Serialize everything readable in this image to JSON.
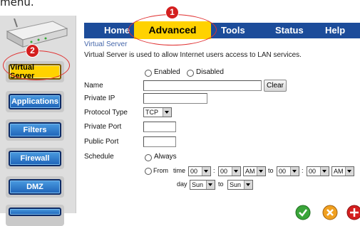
{
  "caption": "menu.",
  "annotations": {
    "badge1": "1",
    "badge2": "2"
  },
  "sidebar": {
    "items": [
      {
        "label": "Virtual Server",
        "active": true
      },
      {
        "label": "Applications"
      },
      {
        "label": "Filters"
      },
      {
        "label": "Firewall"
      },
      {
        "label": "DMZ"
      }
    ]
  },
  "tabs": [
    "Home",
    "Advanced",
    "Tools",
    "Status",
    "Help"
  ],
  "section": {
    "title": "Virtual Server",
    "description": "Virtual Server is used to allow Internet users access to LAN services."
  },
  "form": {
    "enabled_label": "Enabled",
    "disabled_label": "Disabled",
    "name_label": "Name",
    "name_value": "",
    "clear_label": "Clear",
    "private_ip_label": "Private IP",
    "protocol_label": "Protocol Type",
    "protocol_value": "TCP",
    "private_port_label": "Private Port",
    "public_port_label": "Public Port",
    "schedule_label": "Schedule",
    "always_label": "Always",
    "from_label": "From",
    "time_label": "time",
    "from_hour": "00",
    "from_min": "00",
    "from_ampm": "AM",
    "to_label": "to",
    "to_hour": "00",
    "to_min": "00",
    "to_ampm": "AM",
    "colon": ":",
    "day_label": "day",
    "day_from": "Sun",
    "day_to": "Sun"
  },
  "colors": {
    "tab_bar": "#1c4c9a",
    "active": "#ffd200",
    "annotation": "#d41f1f"
  }
}
